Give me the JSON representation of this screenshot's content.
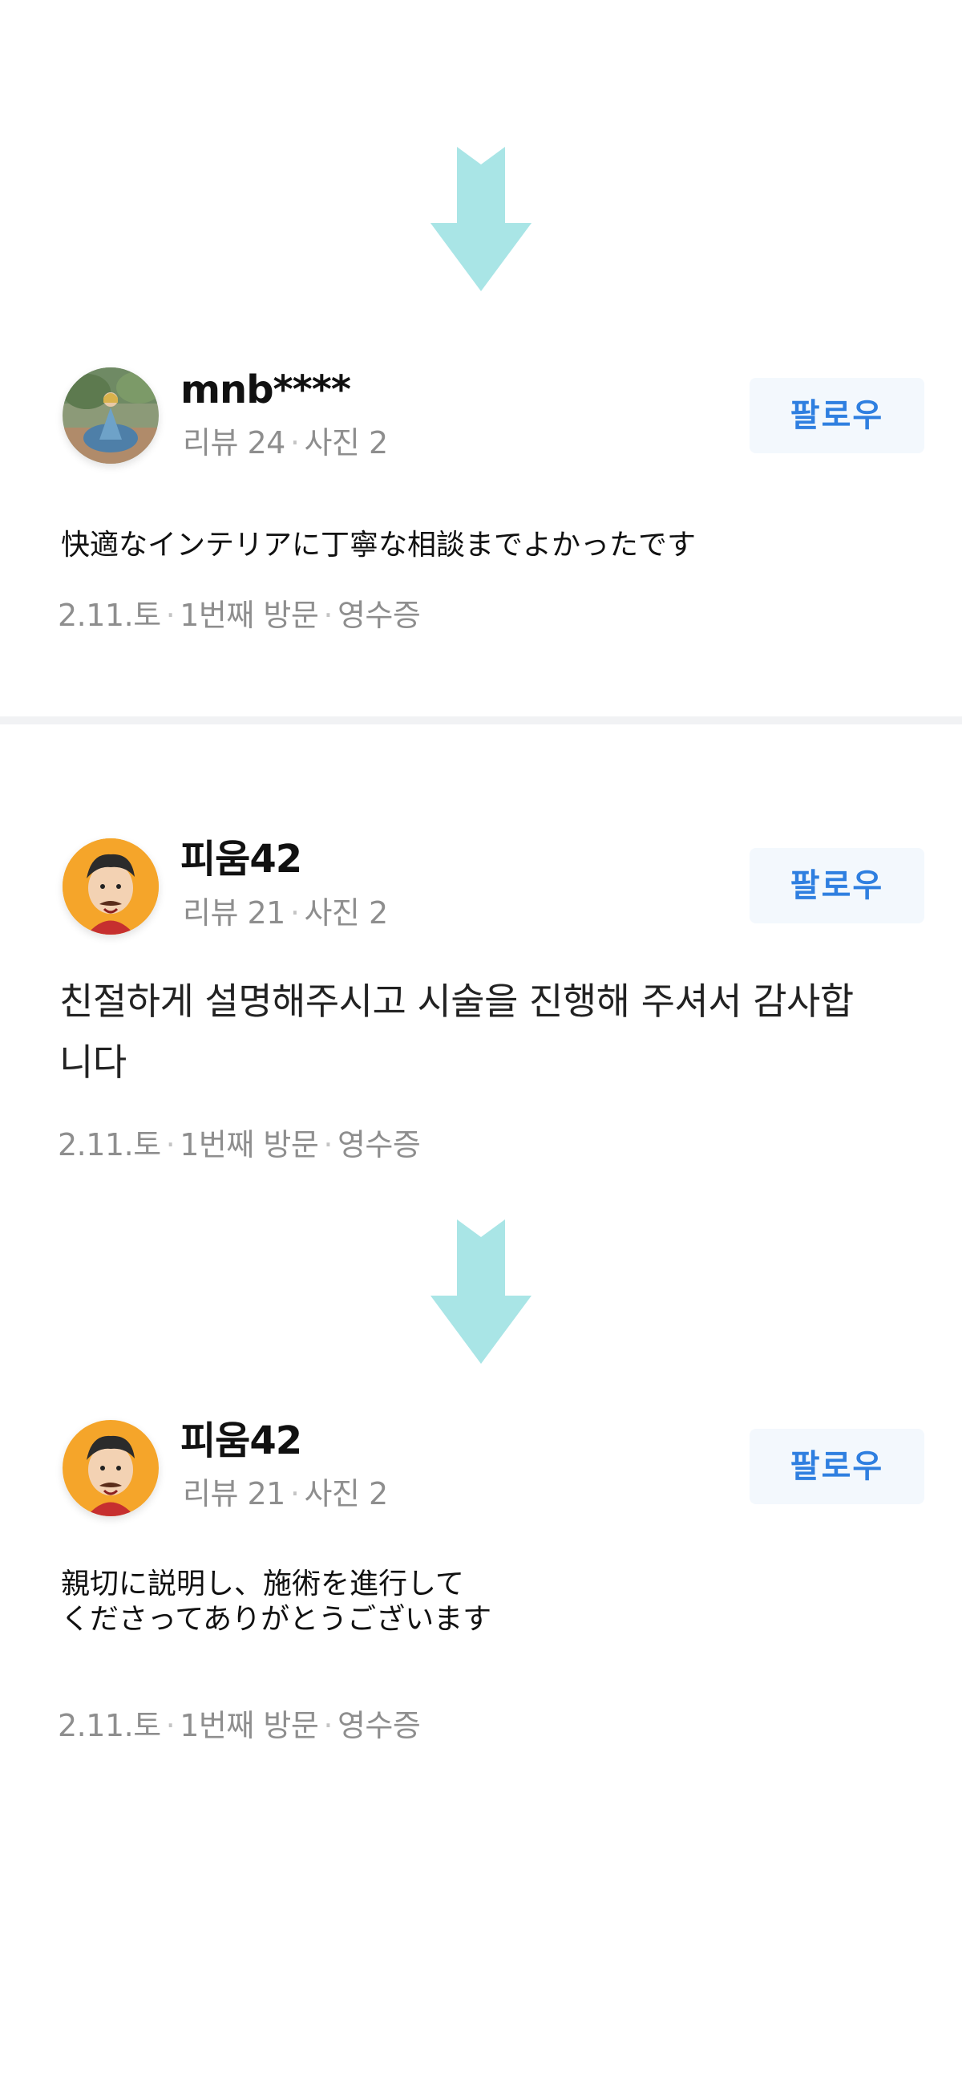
{
  "colors": {
    "arrow": "#a9e5e6",
    "follow_text": "#2f7fe0",
    "follow_bg": "#f3f8fd",
    "muted_text": "#8e8e8e",
    "divider": "#f1f2f4"
  },
  "reviews": [
    {
      "username": "mnb****",
      "review_label": "리뷰 24",
      "photo_label": "사진 2",
      "follow_label": "팔로우",
      "text": "快適なインテリアに丁寧な相談までよかったです",
      "date": "2.11.토",
      "visit": "1번째 방문",
      "receipt": "영수증"
    },
    {
      "username": "피움42",
      "review_label": "리뷰 21",
      "photo_label": "사진 2",
      "follow_label": "팔로우",
      "text": "친절하게 설명해주시고 시술을 진행해 주셔서 감사합\n니다",
      "date": "2.11.토",
      "visit": "1번째 방문",
      "receipt": "영수증"
    },
    {
      "username": "피움42",
      "review_label": "리뷰 21",
      "photo_label": "사진 2",
      "follow_label": "팔로우",
      "text": "親切に説明し、施術を進行して\nくださってありがとうございます",
      "date": "2.11.토",
      "visit": "1번째 방문",
      "receipt": "영수증"
    }
  ]
}
